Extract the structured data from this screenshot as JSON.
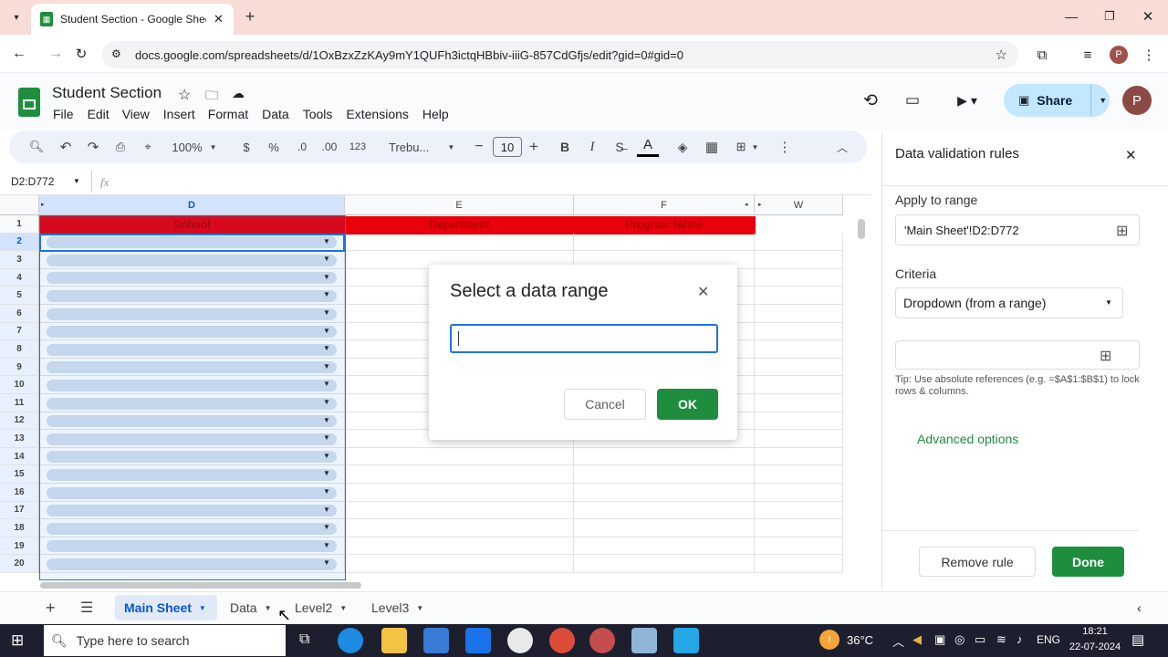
{
  "browser": {
    "tab_title": "Student Section - Google Sheet",
    "url": "docs.google.com/spreadsheets/d/1OxBzxZzKAy9mY1QUFh3ictqHBbiv-iiiG-857CdGfjs/edit?gid=0#gid=0",
    "profile_initial": "P"
  },
  "doc": {
    "title": "Student Section",
    "menus": [
      "File",
      "Edit",
      "View",
      "Insert",
      "Format",
      "Data",
      "Tools",
      "Extensions",
      "Help"
    ],
    "share_label": "Share",
    "avatar_initial": "P"
  },
  "toolbar": {
    "zoom": "100%",
    "currency": "$",
    "percent": "%",
    "dec_decrease": ".0",
    "dec_increase": ".00",
    "number_format": "123",
    "font": "Trebu...",
    "font_size": "10",
    "bold": "B",
    "italic": "I",
    "text_color": "A"
  },
  "formula_bar": {
    "range": "D2:D772",
    "fx": "fx"
  },
  "grid": {
    "columns": [
      "D",
      "E",
      "F",
      "W"
    ],
    "headers": [
      "School",
      "Department",
      "Program Name"
    ],
    "rows": [
      "1",
      "2",
      "3",
      "4",
      "5",
      "6",
      "7",
      "8",
      "9",
      "10",
      "11",
      "12",
      "13",
      "14",
      "15",
      "16",
      "17",
      "18",
      "19",
      "20"
    ]
  },
  "dialog": {
    "title": "Select a data range",
    "input_value": "",
    "cancel": "Cancel",
    "ok": "OK"
  },
  "panel": {
    "title": "Data validation rules",
    "apply_label": "Apply to range",
    "range_value": "'Main Sheet'!D2:D772",
    "criteria_label": "Criteria",
    "criteria_value": "Dropdown (from a range)",
    "tip": "Tip: Use absolute references (e.g. =$A$1:$B$1) to lock rows & columns.",
    "advanced": "Advanced options",
    "remove": "Remove rule",
    "done": "Done"
  },
  "sheets": [
    "Main Sheet",
    "Data",
    "Level2",
    "Level3"
  ],
  "taskbar": {
    "search": "Type here to search",
    "temp": "36°C",
    "lang": "ENG",
    "time": "18:21",
    "date": "22-07-2024"
  },
  "colors": {
    "accent": "#1e8e3e",
    "header_red": "#e8000b",
    "selection": "#1a73e8",
    "share_bg": "#c2e7ff"
  }
}
